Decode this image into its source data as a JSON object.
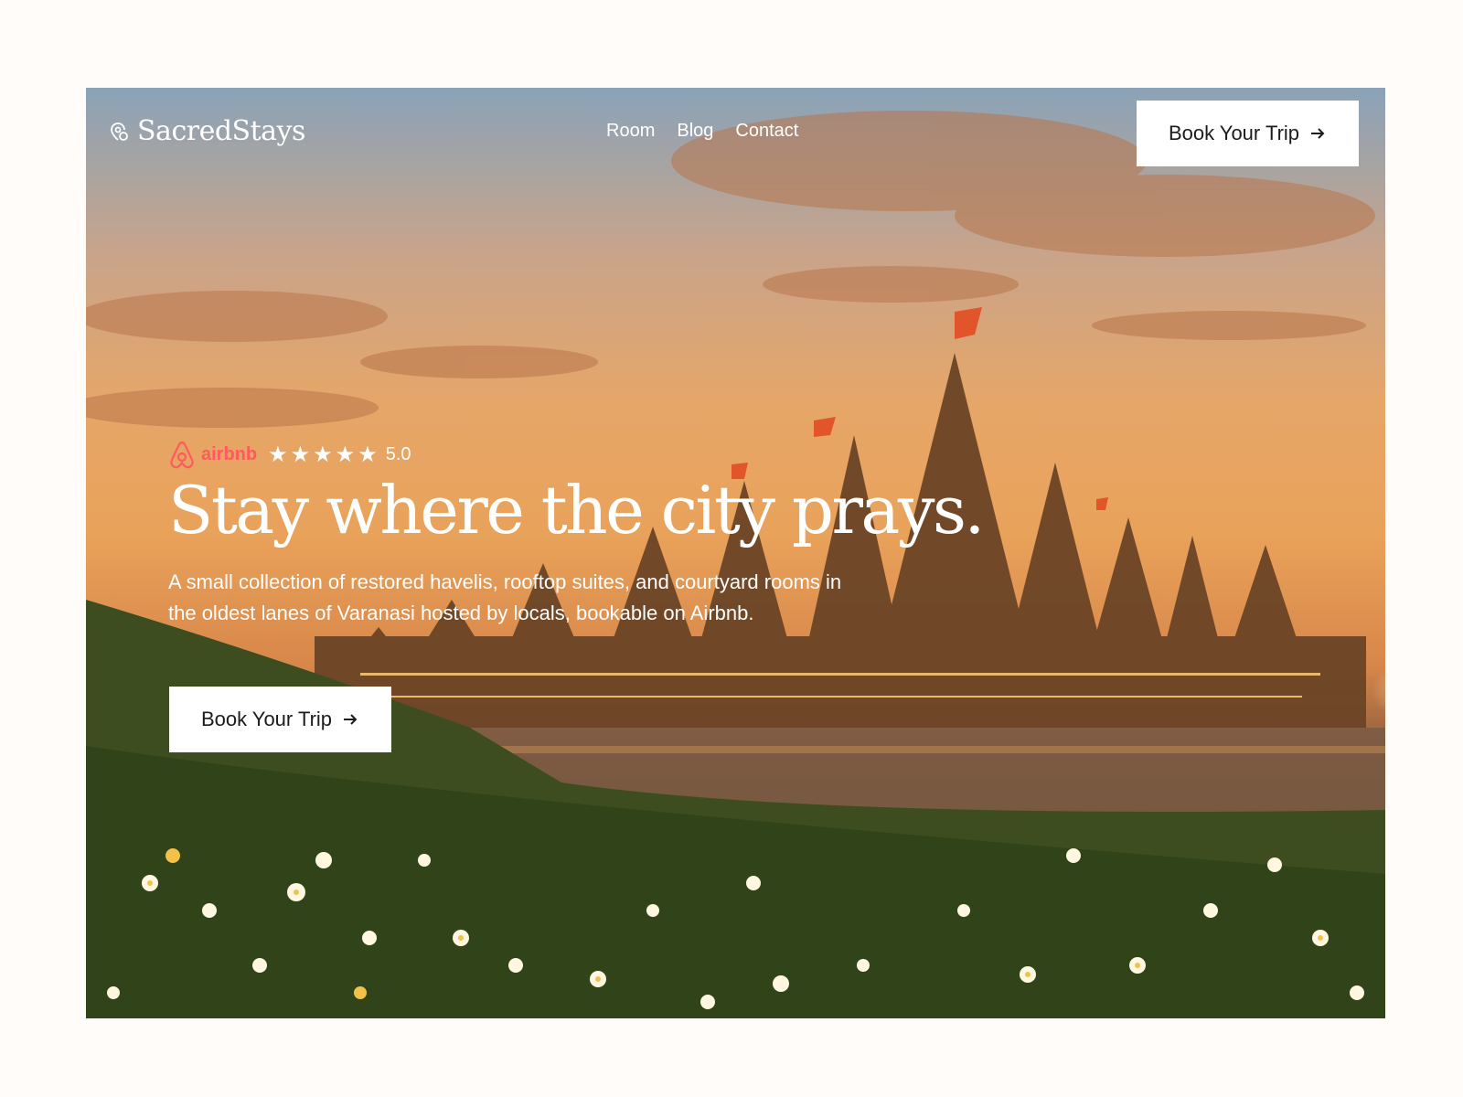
{
  "brand": {
    "name": "SacredStays",
    "logo_icon": "location-pin-icon"
  },
  "nav": {
    "links": [
      "Room",
      "Blog",
      "Contact"
    ]
  },
  "header_cta": {
    "label": "Book Your Trip",
    "icon": "arrow-right-icon"
  },
  "hero": {
    "rating": {
      "platform": "airbnb",
      "stars": "★★★★★",
      "star_count": 5,
      "score": "5.0"
    },
    "headline": "Stay where the city prays.",
    "subtext": "A small collection of restored havelis, rooftop suites, and courtyard rooms in the oldest lanes of Varanasi hosted by locals, bookable on Airbnb.",
    "cta": {
      "label": "Book Your Trip",
      "icon": "arrow-right-icon"
    }
  },
  "colors": {
    "page_bg": "#fffcfa",
    "airbnb": "#ff5a5f",
    "button_bg": "#ffffff",
    "button_text": "#1c1c1c"
  }
}
